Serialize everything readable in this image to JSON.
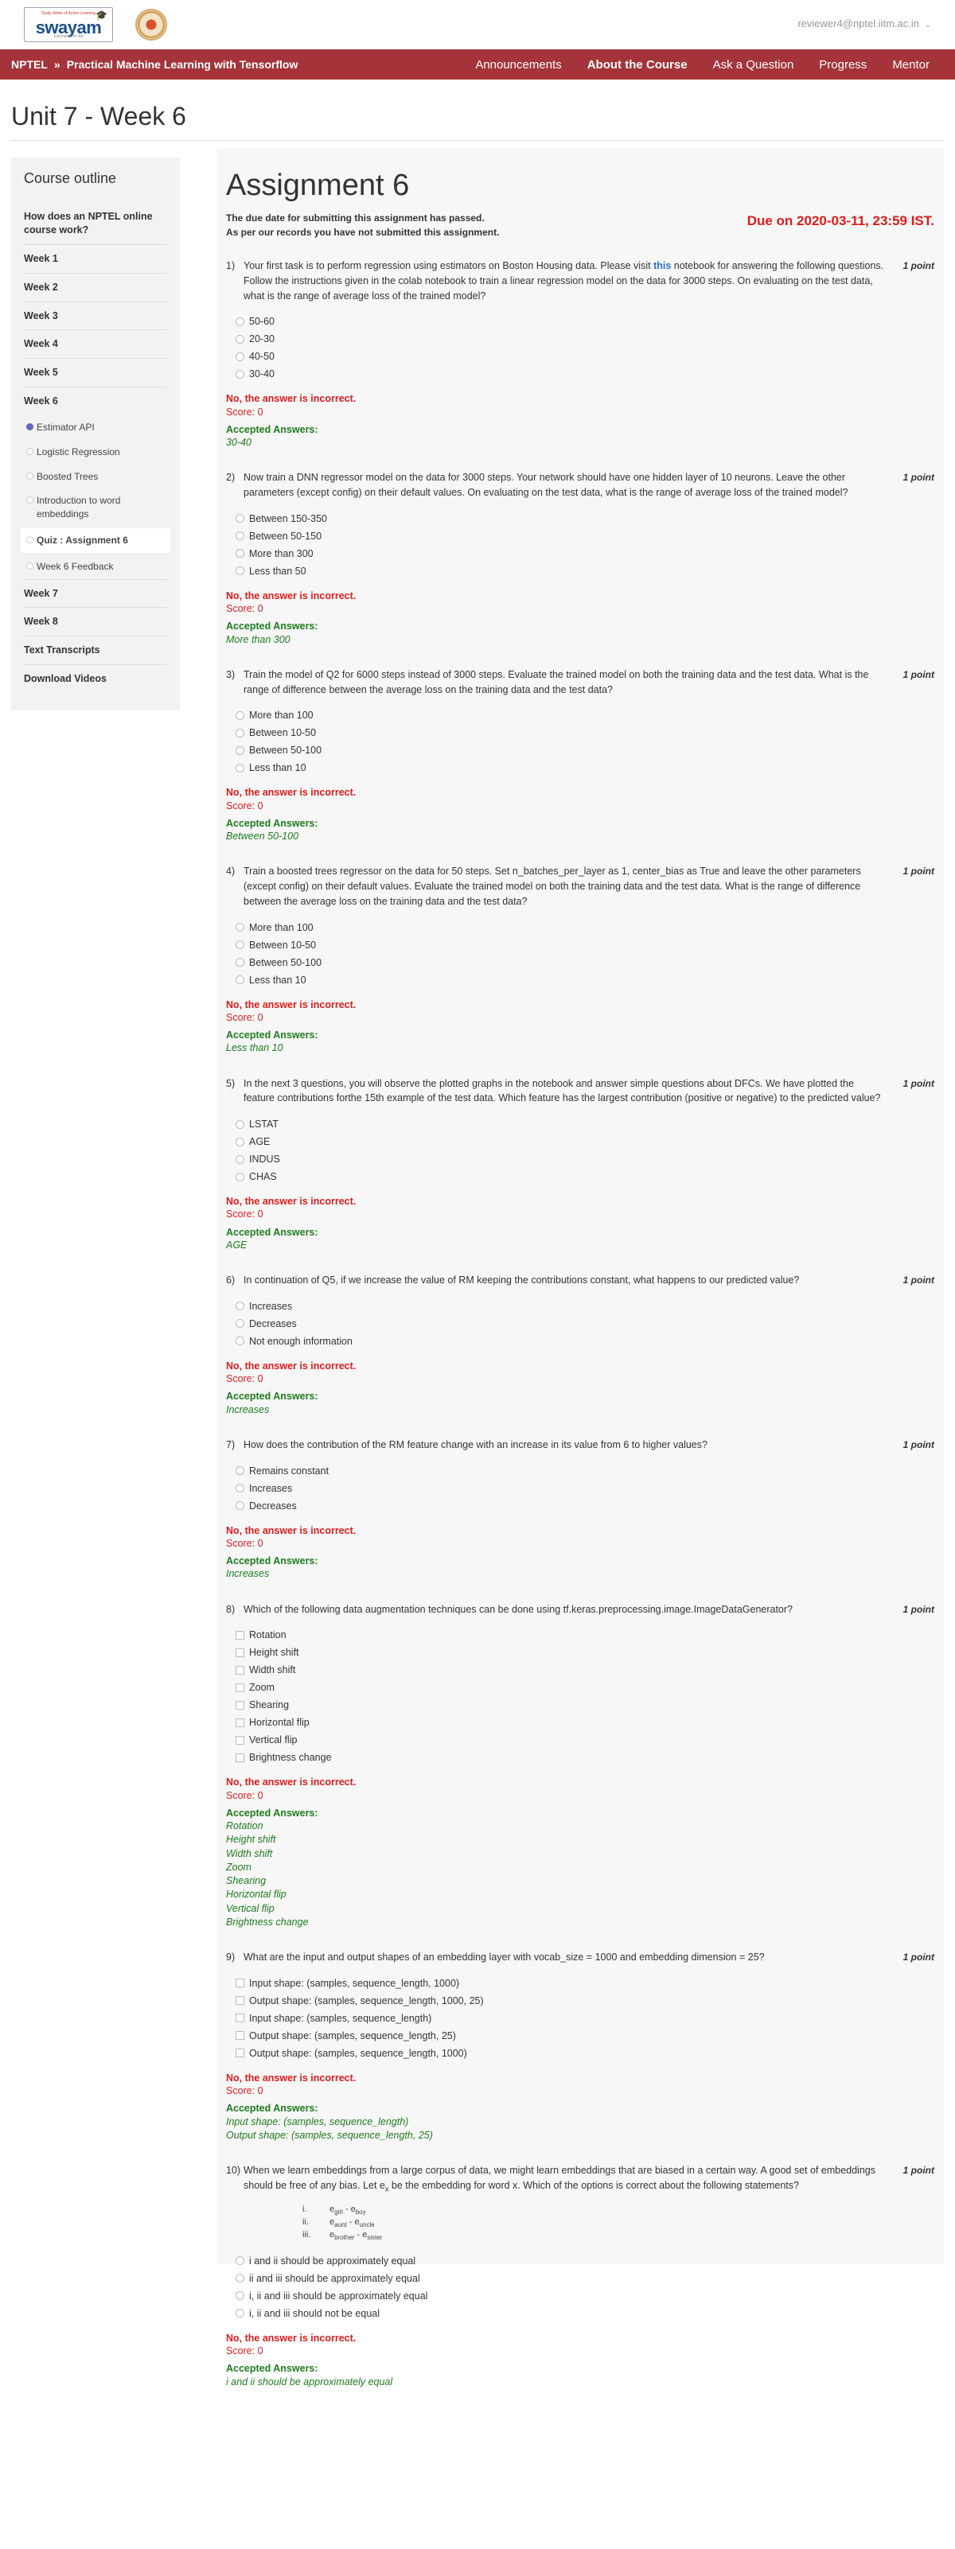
{
  "header": {
    "logo_top_text": "Study Webs of Active Learning",
    "logo_text": "swayam",
    "logo_bottom_text": "Education for All",
    "user_email": "reviewer4@nptel.iitm.ac.in"
  },
  "nav": {
    "brand_org": "NPTEL",
    "brand_sep": "»",
    "brand_course": "Practical Machine Learning with Tensorflow",
    "links": [
      "Announcements",
      "About the Course",
      "Ask a Question",
      "Progress",
      "Mentor"
    ]
  },
  "page_title": "Unit 7 - Week 6",
  "outline": {
    "title": "Course outline",
    "items": [
      "How does an NPTEL online course work?",
      "Week 1",
      "Week 2",
      "Week 3",
      "Week 4",
      "Week 5",
      "Week 6"
    ],
    "week6_sub": [
      "Estimator API",
      "Logistic Regression",
      "Boosted Trees",
      "Introduction to word embeddings",
      "Quiz : Assignment 6",
      "Week 6 Feedback"
    ],
    "after_items": [
      "Week 7",
      "Week 8",
      "Text Transcripts",
      "Download Videos"
    ]
  },
  "assignment": {
    "title": "Assignment 6",
    "due_passed": "The due date for submitting this assignment has passed.",
    "not_submitted": "As per our records you have not submitted this assignment.",
    "due_on": "Due on 2020-03-11, 23:59 IST.",
    "points_label": "1 point",
    "incorrect_label": "No, the answer is incorrect.",
    "score_label": "Score: 0",
    "accepted_label": "Accepted Answers:"
  },
  "questions": [
    {
      "num": "1)",
      "text_before": "Your first task is to perform regression using estimators on Boston Housing data. Please visit ",
      "link": "this",
      "text_after": " notebook for answering the following questions. Follow the instructions given in the colab notebook to train a linear regression model on the data for 3000 steps. On evaluating on the test data, what is the range of average loss of the trained model?",
      "options": [
        "50-60",
        "20-30",
        "40-50",
        "30-40"
      ],
      "accepted": [
        "30-40"
      ]
    },
    {
      "num": "2)",
      "text": "Now train a DNN regressor model on the data for 3000 steps. Your network should have one hidden layer of 10 neurons. Leave the other parameters (except config) on their default values. On evaluating on the test data, what is the range of average loss of the trained model?",
      "options": [
        "Between 150-350",
        "Between 50-150",
        "More than 300",
        "Less than 50"
      ],
      "accepted": [
        "More than 300"
      ]
    },
    {
      "num": "3)",
      "text": "Train the model of Q2 for 6000 steps instead of 3000 steps. Evaluate the trained model on both the training data and the test data. What is the range of difference between the average loss on the training data and the test data?",
      "options": [
        "More than 100",
        "Between 10-50",
        "Between 50-100",
        "Less than 10"
      ],
      "accepted": [
        "Between 50-100"
      ]
    },
    {
      "num": "4)",
      "text": "Train a boosted trees regressor on the data for 50 steps. Set n_batches_per_layer as 1, center_bias as True and leave the other parameters (except config) on their default values. Evaluate the trained model on both the training data and the test data. What is the range of difference between the average loss on the training data and the test data?",
      "options": [
        "More than 100",
        "Between 10-50",
        "Between 50-100",
        "Less than 10"
      ],
      "accepted": [
        "Less than 10"
      ]
    },
    {
      "num": "5)",
      "text": "In the next 3 questions, you will observe the plotted graphs in the notebook and answer simple questions about DFCs. We have plotted the feature contributions forthe 15th example of the test data. Which feature has the largest contribution (positive or negative) to the predicted value?",
      "options": [
        "LSTAT",
        "AGE",
        "INDUS",
        "CHAS"
      ],
      "accepted": [
        "AGE"
      ]
    },
    {
      "num": "6)",
      "text": "In continuation of Q5, if we increase the value of RM keeping the contributions constant, what happens to our predicted value?",
      "options": [
        "Increases",
        "Decreases",
        "Not enough information"
      ],
      "accepted": [
        "Increases"
      ]
    },
    {
      "num": "7)",
      "text": "How does the contribution of the RM feature change with an increase in its value from 6 to higher values?",
      "options": [
        "Remains constant",
        "Increases",
        "Decreases"
      ],
      "accepted": [
        "Increases"
      ]
    },
    {
      "num": "8)",
      "text": "Which of the following data augmentation techniques can be done using tf.keras.preprocessing.image.ImageDataGenerator?",
      "options": [
        "Rotation",
        "Height shift",
        "Width shift",
        "Zoom",
        "Shearing",
        "Horizontal flip",
        "Vertical flip",
        "Brightness change"
      ],
      "accepted": [
        "Rotation",
        "Height shift",
        "Width shift",
        "Zoom",
        "Shearing",
        "Horizontal flip",
        "Vertical flip",
        "Brightness change"
      ]
    },
    {
      "num": "9)",
      "text": "What are the input and output shapes of an embedding layer with vocab_size = 1000 and embedding dimension = 25?",
      "options": [
        "Input shape: (samples, sequence_length, 1000)",
        "Output shape: (samples, sequence_length, 1000, 25)",
        "Input shape: (samples, sequence_length)",
        "Output shape: (samples, sequence_length, 25)",
        "Output shape: (samples, sequence_length, 1000)"
      ],
      "accepted": [
        "Input shape: (samples, sequence_length)",
        "Output shape: (samples, sequence_length, 25)"
      ]
    },
    {
      "num": "10)",
      "text": "When we learn embeddings from a large corpus of data, we might learn embeddings that are biased in a certain way. A good set of embeddings should be free of any bias. Let e",
      "text_sub": "x",
      "text_after": " be the embedding for word x. Which of the options is correct about the following statements?",
      "statements": [
        {
          "n": "i.",
          "a": "girl",
          "b": "boy"
        },
        {
          "n": "ii.",
          "a": "aunt",
          "b": "uncle"
        },
        {
          "n": "iii.",
          "a": "brother",
          "b": "sister"
        }
      ],
      "options": [
        "i and ii should be approximately equal",
        "ii and iii should be approximately equal",
        "i, ii and iii should be approximately equal",
        "i, ii and iii should not be equal"
      ],
      "accepted": [
        "i and ii should be approximately equal"
      ]
    }
  ]
}
